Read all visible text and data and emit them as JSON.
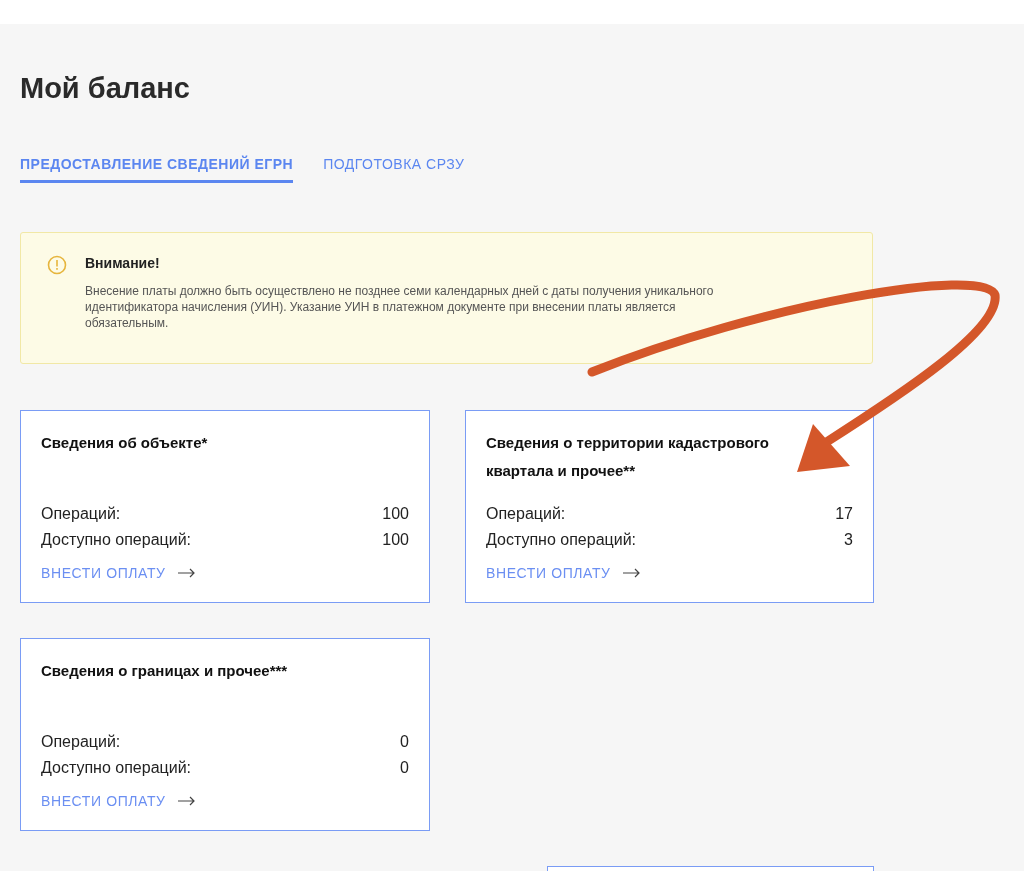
{
  "page": {
    "title": "Мой баланс"
  },
  "tabs": [
    {
      "label": "ПРЕДОСТАВЛЕНИЕ СВЕДЕНИЙ ЕГРН",
      "selected": true
    },
    {
      "label": "ПОДГОТОВКА СРЗУ",
      "selected": false
    }
  ],
  "alert": {
    "title": "Внимание!",
    "text": "Внесение платы должно быть осуществлено не позднее семи календарных дней с даты получения уникального идентификатора начисления (УИН). Указание УИН в платежном документе при внесении платы является обязательным."
  },
  "cards": [
    {
      "title": "Сведения об объекте*",
      "rows": [
        {
          "label": "Операций:",
          "value": "100"
        },
        {
          "label": "Доступно операций:",
          "value": "100"
        }
      ],
      "action": "ВНЕСТИ ОПЛАТУ"
    },
    {
      "title": "Сведения о территории кадастрового квартала и прочее**",
      "rows": [
        {
          "label": "Операций:",
          "value": "17"
        },
        {
          "label": "Доступно операций:",
          "value": "3"
        }
      ],
      "action": "ВНЕСТИ ОПЛАТУ"
    },
    {
      "title": "Сведения о границах и прочее***",
      "rows": [
        {
          "label": "Операций:",
          "value": "0"
        },
        {
          "label": "Доступно операций:",
          "value": "0"
        }
      ],
      "action": "ВНЕСТИ ОПЛАТУ"
    }
  ]
}
